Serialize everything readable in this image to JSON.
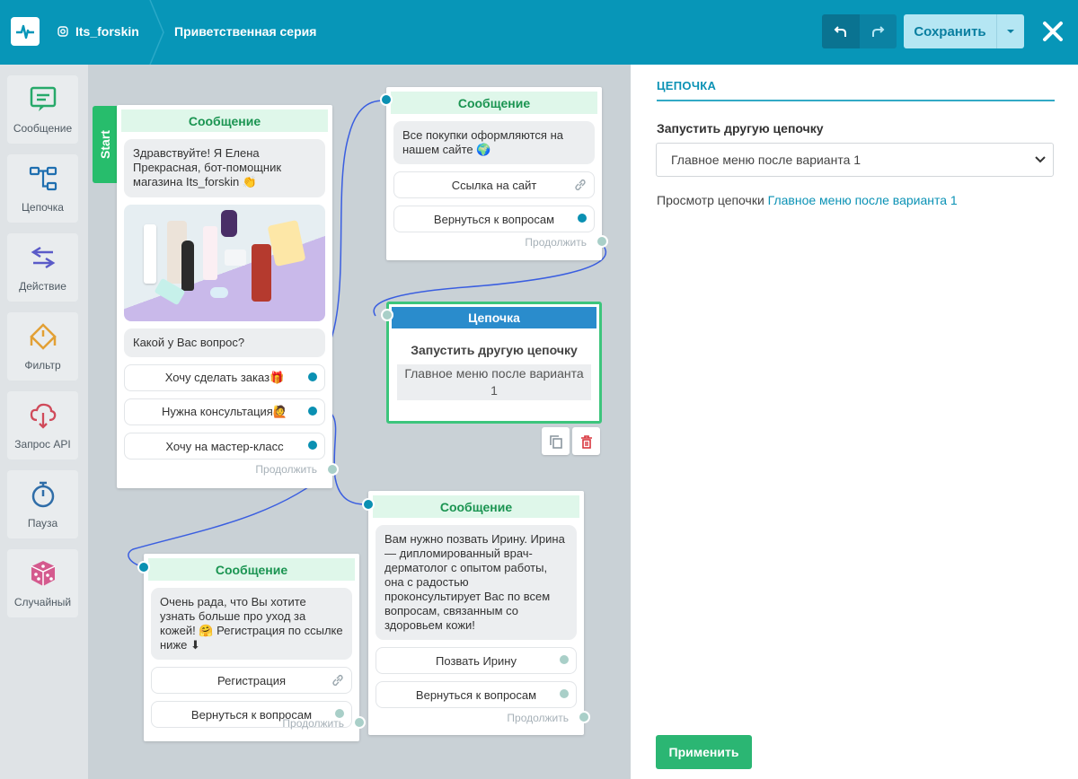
{
  "header": {
    "account": "Its_forskin",
    "title": "Приветственная серия",
    "save_label": "Сохранить"
  },
  "sidebar": {
    "tools": [
      {
        "label": "Сообщение",
        "icon": "message-icon"
      },
      {
        "label": "Цепочка",
        "icon": "chain-icon"
      },
      {
        "label": "Действие",
        "icon": "action-icon"
      },
      {
        "label": "Фильтр",
        "icon": "filter-icon"
      },
      {
        "label": "Запрос API",
        "icon": "api-icon"
      },
      {
        "label": "Пауза",
        "icon": "pause-icon"
      },
      {
        "label": "Случайный",
        "icon": "dice-icon"
      }
    ]
  },
  "canvas": {
    "start_label": "Start",
    "node_start": {
      "header": "Сообщение",
      "text1": "Здравствуйте! Я Елена Прекрасная, бот-помощник магазина Its_forskin 👏",
      "text2": "Какой у Вас вопрос?",
      "buttons": [
        "Хочу сделать заказ🎁",
        "Нужна консультация🙋",
        "Хочу на мастер-класс"
      ],
      "continue": "Продолжить"
    },
    "node_site": {
      "header": "Сообщение",
      "text": "Все покупки оформляются на нашем сайте 🌍",
      "buttons": [
        "Ссылка на сайт",
        "Вернуться к вопросам"
      ],
      "continue": "Продолжить"
    },
    "node_chain": {
      "header": "Цепочка",
      "title": "Запустить другую цепочку",
      "value": "Главное меню после варианта 1"
    },
    "node_irina": {
      "header": "Сообщение",
      "text": "Вам нужно позвать Ирину. Ирина — дипломированный врач-дерматолог с опытом работы, она с радостью проконсультирует Вас по всем вопросам, связанным со здоровьем кожи!",
      "buttons": [
        "Позвать Ирину",
        "Вернуться к вопросам"
      ],
      "continue": "Продолжить"
    },
    "node_register": {
      "header": "Сообщение",
      "text": "Очень рада, что Вы хотите узнать больше про уход за кожей! 🤗 Регистрация по ссылке ниже ⬇",
      "buttons": [
        "Регистрация",
        "Вернуться к вопросам"
      ],
      "continue": "Продолжить"
    }
  },
  "panel": {
    "section_title": "ЦЕПОЧКА",
    "field_label": "Запустить другую цепочку",
    "select_value": "Главное меню после варианта 1",
    "view_prefix": "Просмотр цепочки",
    "view_link": "Главное меню после варианта 1",
    "apply_label": "Применить"
  },
  "colors": {
    "topbar": "#0796b8",
    "node_header_green": "#dff7ea",
    "chain_header_blue": "#2a8ccc",
    "apply_green": "#2bb673",
    "link_blue": "#0b92b5"
  }
}
